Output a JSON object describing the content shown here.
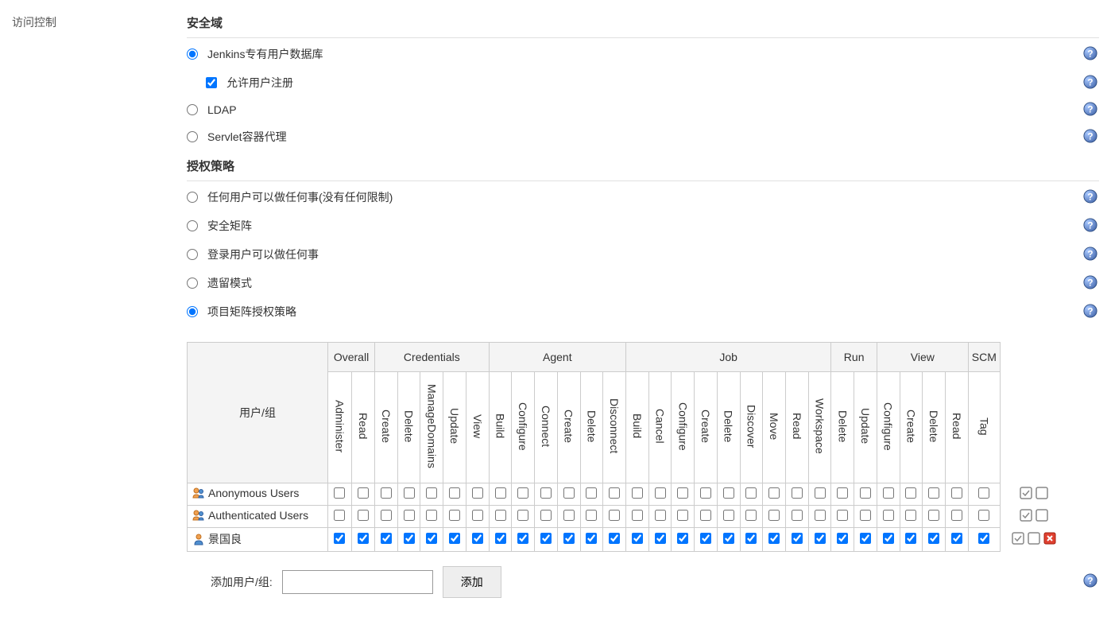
{
  "sidebar": {
    "access_control": "访问控制"
  },
  "sections": {
    "security_realm": "安全域",
    "authorization": "授权策略"
  },
  "realm_options": {
    "jenkins_db": "Jenkins专有用户数据库",
    "allow_signup": "允许用户注册",
    "ldap": "LDAP",
    "servlet": "Servlet容器代理"
  },
  "auth_options": {
    "anyone": "任何用户可以做任何事(没有任何限制)",
    "matrix": "安全矩阵",
    "logged_in": "登录用户可以做任何事",
    "legacy": "遗留模式",
    "project_matrix": "项目矩阵授权策略"
  },
  "table": {
    "user_group_header": "用户/组",
    "groups": [
      {
        "name": "Overall",
        "perms": [
          "Administer",
          "Read"
        ]
      },
      {
        "name": "Credentials",
        "perms": [
          "Create",
          "Delete",
          "ManageDomains",
          "Update",
          "View"
        ]
      },
      {
        "name": "Agent",
        "perms": [
          "Build",
          "Configure",
          "Connect",
          "Create",
          "Delete",
          "Disconnect"
        ]
      },
      {
        "name": "Job",
        "perms": [
          "Build",
          "Cancel",
          "Configure",
          "Create",
          "Delete",
          "Discover",
          "Move",
          "Read",
          "Workspace"
        ]
      },
      {
        "name": "Run",
        "perms": [
          "Delete",
          "Update"
        ]
      },
      {
        "name": "View",
        "perms": [
          "Configure",
          "Create",
          "Delete",
          "Read"
        ]
      },
      {
        "name": "SCM",
        "perms": [
          "Tag"
        ]
      }
    ],
    "rows": [
      {
        "name": "Anonymous Users",
        "icon": "group",
        "checked": false,
        "deletable": false
      },
      {
        "name": "Authenticated Users",
        "icon": "group",
        "checked": false,
        "deletable": false
      },
      {
        "name": "景国良",
        "icon": "user",
        "checked": true,
        "deletable": true
      }
    ]
  },
  "add": {
    "label": "添加用户/组:",
    "button": "添加"
  }
}
